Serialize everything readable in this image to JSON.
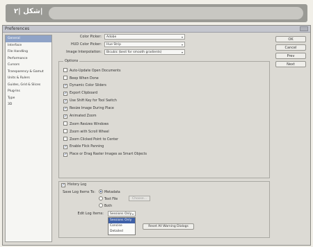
{
  "caption": {
    "label": "شکل |۲|"
  },
  "window": {
    "title": "Preferences"
  },
  "sidebar": {
    "items": [
      {
        "label": "General",
        "active": true
      },
      {
        "label": "Interface"
      },
      {
        "label": "File Handling"
      },
      {
        "label": "Performance"
      },
      {
        "label": "Cursors"
      },
      {
        "label": "Transparency & Gamut"
      },
      {
        "label": "Units & Rulers"
      },
      {
        "label": "Guides, Grid & Slices"
      },
      {
        "label": "Plug-Ins"
      },
      {
        "label": "Type"
      },
      {
        "label": "3D"
      }
    ]
  },
  "buttons": {
    "ok": "OK",
    "cancel": "Cancel",
    "prev": "Prev",
    "next": "Next"
  },
  "fields": {
    "color_picker": {
      "label": "Color Picker:",
      "value": "Adobe"
    },
    "hud_color_picker": {
      "label": "HUD Color Picker:",
      "value": "Hue Strip"
    },
    "image_interpolation": {
      "label": "Image Interpolation:",
      "value": "Bicubic (best for smooth gradients)"
    }
  },
  "options": {
    "title": "Options",
    "items": [
      {
        "label": "Auto-Update Open Documents",
        "checked": false
      },
      {
        "label": "Beep When Done",
        "checked": false
      },
      {
        "label": "Dynamic Color Sliders",
        "checked": true
      },
      {
        "label": "Export Clipboard",
        "checked": true
      },
      {
        "label": "Use Shift Key for Tool Switch",
        "checked": true
      },
      {
        "label": "Resize Image During Place",
        "checked": true
      },
      {
        "label": "Animated Zoom",
        "checked": true
      },
      {
        "label": "Zoom Resizes Windows",
        "checked": false
      },
      {
        "label": "Zoom with Scroll Wheel",
        "checked": false
      },
      {
        "label": "Zoom Clicked Point to Center",
        "checked": false
      },
      {
        "label": "Enable Flick Panning",
        "checked": true
      },
      {
        "label": "Place or Drag Raster Images as Smart Objects",
        "checked": true
      }
    ]
  },
  "history": {
    "checkbox_label": "History Log",
    "checked": true,
    "save_label": "Save Log Items To:",
    "radios": [
      {
        "label": "Metadata",
        "selected": true
      },
      {
        "label": "Text File",
        "selected": false
      },
      {
        "label": "Both",
        "selected": false
      }
    ],
    "choose_label": "Choose...",
    "edit_label": "Edit Log Items:",
    "edit_value": "Sessions Only",
    "dropdown_options": [
      "Sessions Only",
      "Concise",
      "Detailed"
    ],
    "dropdown_highlighted": 0
  },
  "reset_label": "Reset All Warning Dialogs",
  "check_glyph": "✓",
  "arrow_glyph": "▾"
}
